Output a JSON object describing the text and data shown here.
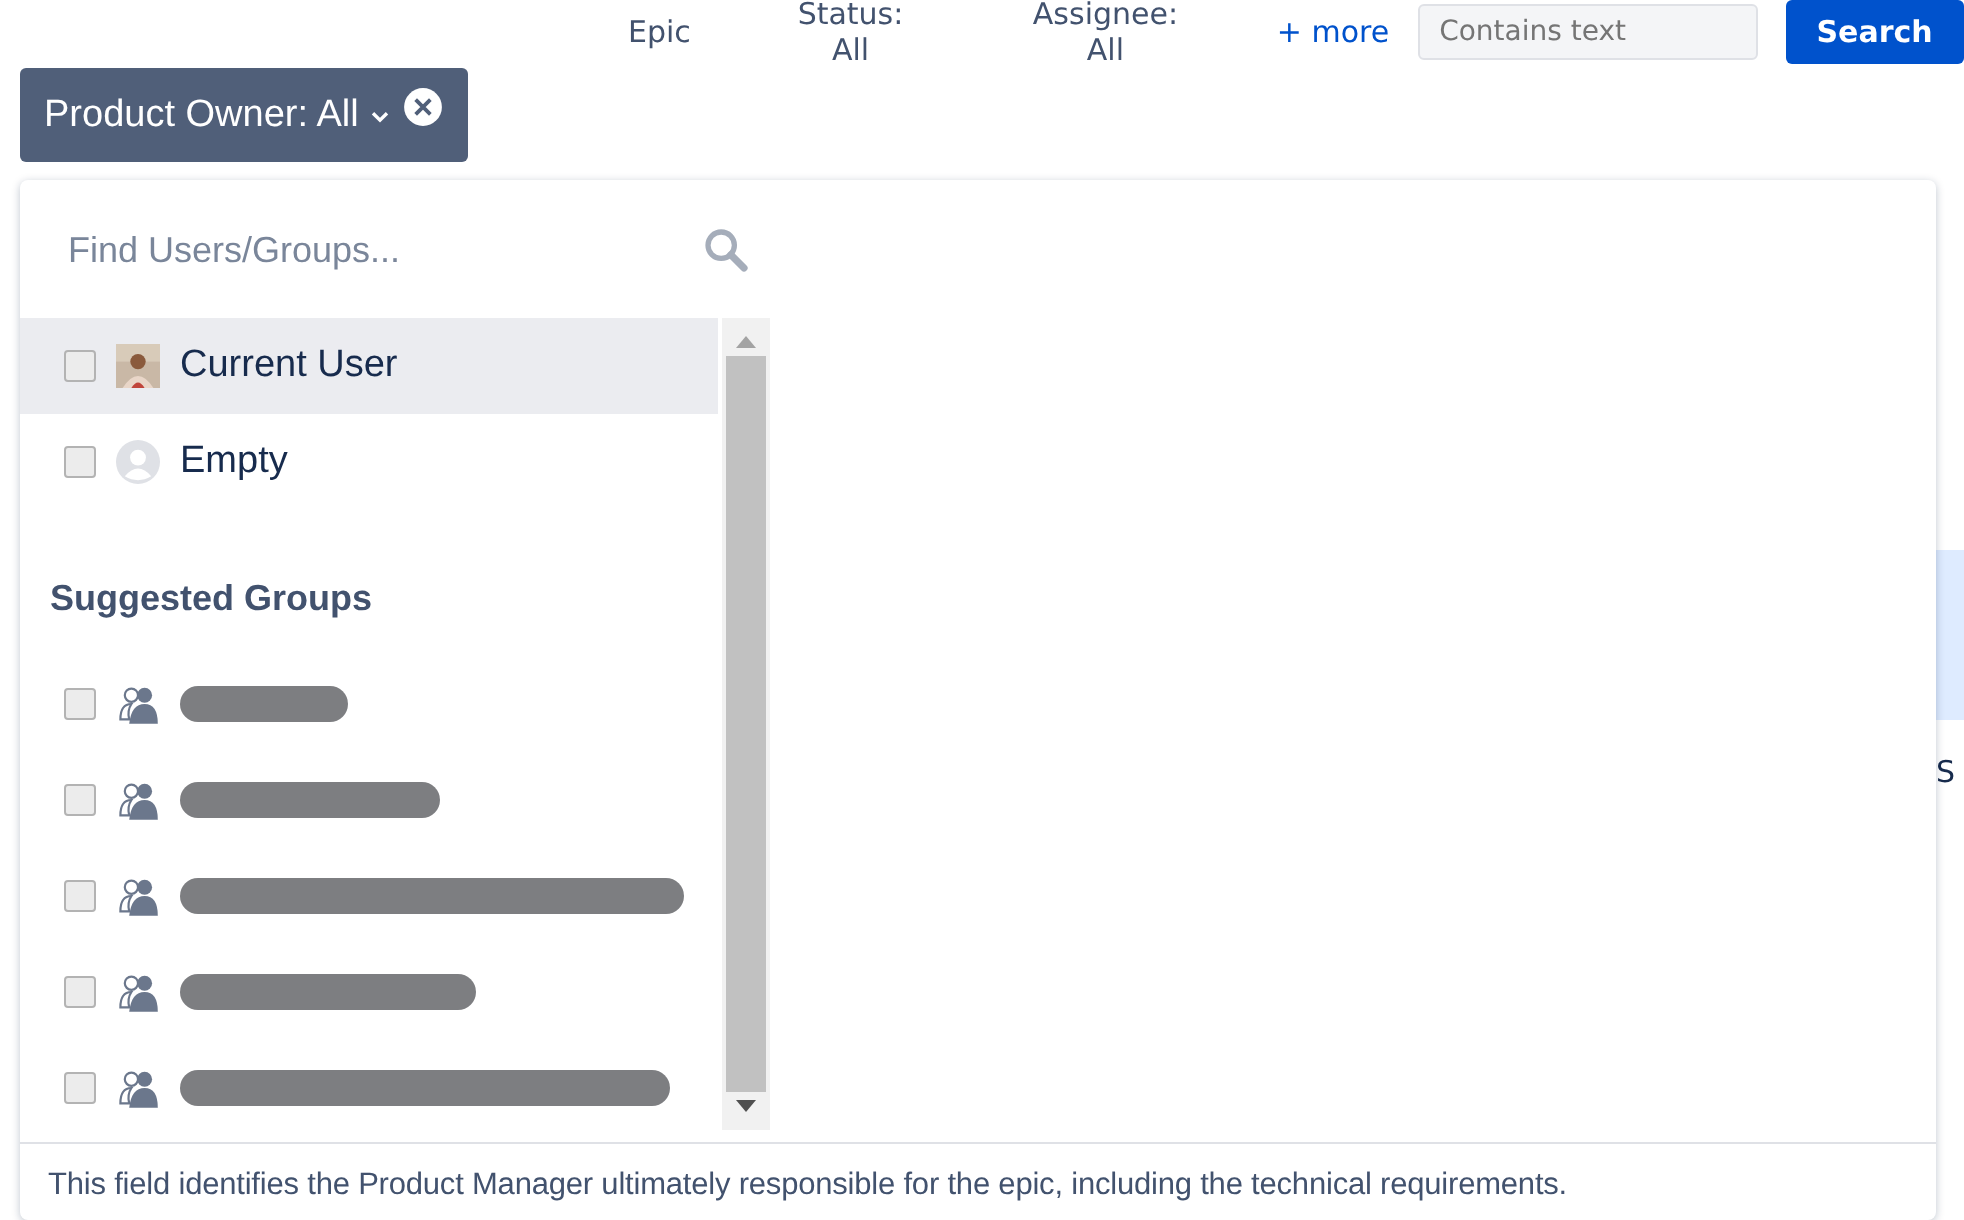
{
  "top_filters": [
    {
      "label": "Epic"
    },
    {
      "label": "Status: All"
    },
    {
      "label": "Assignee: All"
    }
  ],
  "more_link": "+ more",
  "text_search": {
    "placeholder": "Contains text"
  },
  "search_button": "Search",
  "active_filter": {
    "label": "Product Owner: All",
    "expanded": true
  },
  "dropdown": {
    "search": {
      "placeholder": "Find Users/Groups..."
    },
    "users": [
      {
        "name": "Current User",
        "checked": false,
        "selected": true
      },
      {
        "name": "Empty",
        "kind": "placeholder",
        "checked": false,
        "selected": false
      }
    ],
    "groups_heading": "Suggested Groups",
    "groups": [
      {
        "checked": false
      },
      {
        "checked": false
      },
      {
        "checked": false
      },
      {
        "checked": false
      },
      {
        "checked": false
      }
    ],
    "description": "This field identifies the Product Manager ultimately responsible for the epic, including the technical requirements."
  },
  "background_fragments": [
    "S"
  ]
}
